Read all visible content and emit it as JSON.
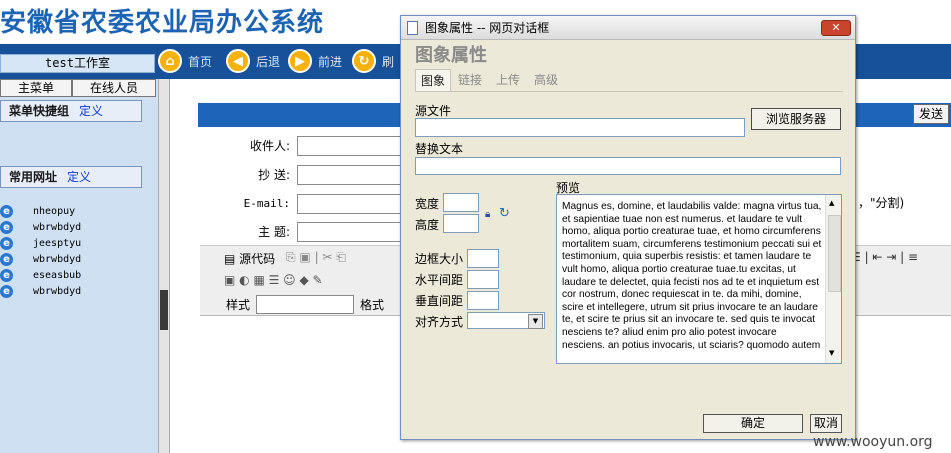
{
  "app": {
    "title": "安徽省农委农业局办公系统",
    "user_box": "test工作室"
  },
  "nav": {
    "home": "首页",
    "back": "后退",
    "forward": "前进",
    "refresh": "刷"
  },
  "sidebar": {
    "tabs": [
      "主菜单",
      "在线人员"
    ],
    "quick_group_title": "菜单快捷组",
    "quick_group_define": "定义",
    "common_urls_title": "常用网址",
    "common_urls_define": "定义",
    "urls": [
      "nheopuy",
      "wbrwbdyd",
      "jeesptyu",
      "wbrwbdyd",
      "eseasbub",
      "wbrwbdyd"
    ]
  },
  "mail_form": {
    "send_label": "发送",
    "recipient_label": "收件人:",
    "cc_label": "抄  送:",
    "email_label": "E-mail:",
    "subject_label": "主  题:",
    "separator_note": "，\"分割)"
  },
  "editor": {
    "source_code_label": "源代码",
    "style_label": "样式",
    "format_label": "格式"
  },
  "dialog": {
    "window_title": "图象属性 -- 网页对话框",
    "close_label": "✕",
    "heading": "图象属性",
    "tabs": [
      "图象",
      "链接",
      "上传",
      "高级"
    ],
    "source_file_label": "源文件",
    "browse_button": "浏览服务器",
    "alt_text_label": "替换文本",
    "width_label": "宽度",
    "height_label": "高度",
    "border_label": "边框大小",
    "hspace_label": "水平间距",
    "vspace_label": "垂直间距",
    "align_label": "对齐方式",
    "preview_label": "预览",
    "preview_text": "Magnus es, domine, et laudabilis valde: magna virtus tua, et sapientiae tuae non est numerus. et laudare te vult homo, aliqua portio creaturae tuae, et homo circumferens mortalitem suam, circumferens testimonium peccati sui et testimonium, quia superbis resistis: et tamen laudare te vult homo, aliqua portio creaturae tuae.tu excitas, ut laudare te delectet, quia fecisti nos ad te et inquietum est cor nostrum, donec requiescat in te. da mihi, domine, scire et intellegere, utrum sit prius invocare te an laudare te, et scire te prius sit an invocare te. sed quis te invocat nesciens te? aliud enim pro alio potest invocare nesciens. an potius invocaris, ut sciaris? quomodo autem",
    "ok_button": "确定",
    "cancel_button": "取消"
  },
  "watermark": "www.wooyun.org",
  "colors": {
    "brand_blue": "#1d63b4",
    "toolbar_blue": "#17519a",
    "dialog_bg": "#ece9d8"
  }
}
